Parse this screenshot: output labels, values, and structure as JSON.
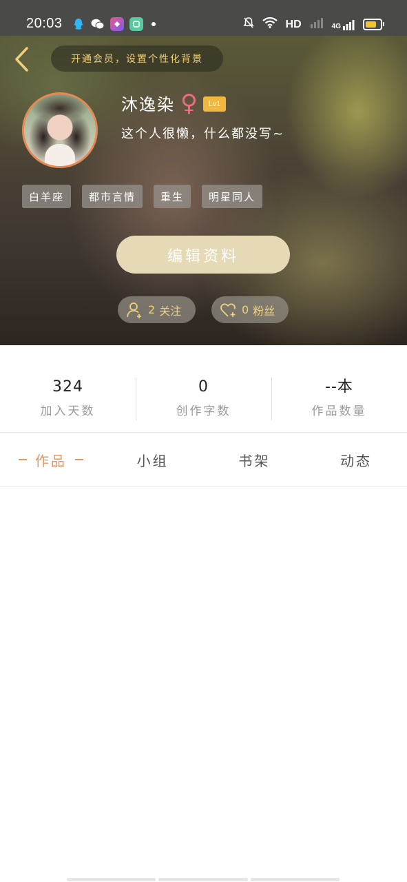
{
  "status_bar": {
    "time": "20:03",
    "network_label": "HD",
    "cellular_label": "4G",
    "app_icons": [
      "qq-icon",
      "wechat-icon",
      "app-icon",
      "app-icon"
    ]
  },
  "header": {
    "vip_prompt": "开通会员，设置个性化背景",
    "nickname": "沐逸染",
    "gender_symbol": "♀",
    "level": "Lv1",
    "bio": "这个人很懒，什么都没写~",
    "tags": [
      "白羊座",
      "都市言情",
      "重生",
      "明星同人"
    ],
    "edit_button": "编辑资料",
    "follow": {
      "count": "2",
      "label": "关注"
    },
    "fans": {
      "count": "0",
      "label": "粉丝"
    }
  },
  "stats": [
    {
      "value": "324",
      "label": "加入天数"
    },
    {
      "value": "0",
      "label": "创作字数"
    },
    {
      "value": "--本",
      "label": "作品数量"
    }
  ],
  "tabs": [
    {
      "label": "作品",
      "active": true
    },
    {
      "label": "小组",
      "active": false
    },
    {
      "label": "书架",
      "active": false
    },
    {
      "label": "动态",
      "active": false
    }
  ],
  "colors": {
    "accent": "#e8955e",
    "gold_text": "#f0d07a",
    "edit_button_bg": "#e6d9b6",
    "level_badge": "#f0b840",
    "female": "#f06a86"
  }
}
